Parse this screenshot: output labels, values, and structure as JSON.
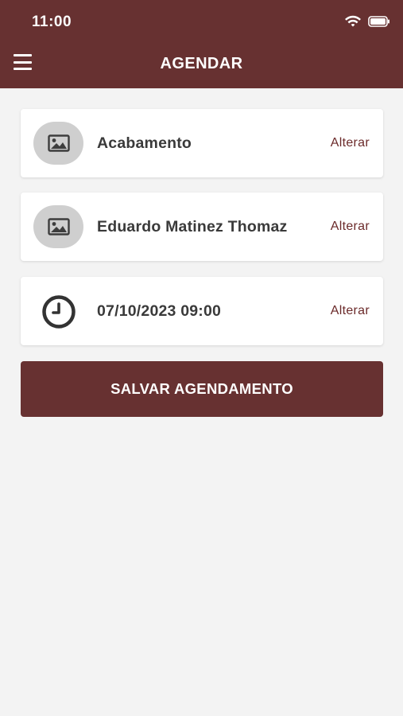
{
  "status_bar": {
    "time": "11:00"
  },
  "header": {
    "title": "AGENDAR"
  },
  "items": [
    {
      "label": "Acabamento",
      "action": "Alterar",
      "icon": "image-icon"
    },
    {
      "label": "Eduardo Matinez Thomaz",
      "action": "Alterar",
      "icon": "image-icon"
    },
    {
      "label": "07/10/2023 09:00",
      "action": "Alterar",
      "icon": "clock-icon"
    }
  ],
  "save_button": {
    "label": "SALVAR AGENDAMENTO"
  },
  "colors": {
    "primary": "#673131",
    "background": "#f3f3f3",
    "accent_text": "#6b2a2a"
  }
}
